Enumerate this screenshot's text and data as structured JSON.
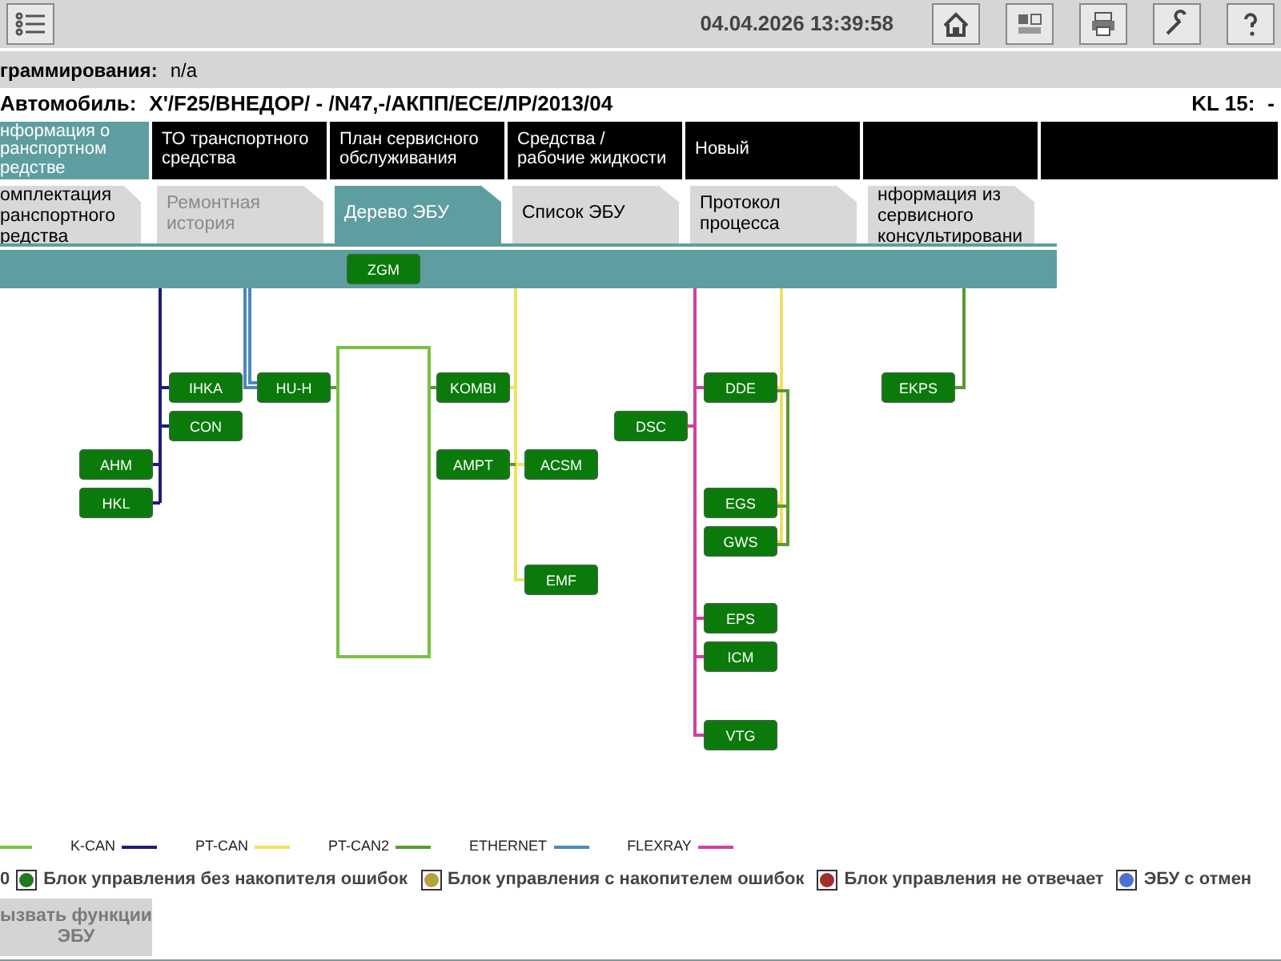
{
  "header": {
    "datetime": "04.04.2026 13:39:58"
  },
  "info": {
    "program_label": "граммирования:",
    "program_value": "n/a",
    "vehicle_label": "Автомобиль:",
    "vehicle_value": "X'/F25/ВНЕДОР/ - /N47,-/АКПП/ЕСЕ/ЛР/2013/04",
    "kl_label": "KL 15:",
    "kl_value": "-"
  },
  "main_tabs": [
    {
      "label": "нформация о\nранспортном\nредстве",
      "selected": true
    },
    {
      "label": "ТО транспортного\nсредства",
      "selected": false
    },
    {
      "label": "План сервисного\nобслуживания",
      "selected": false
    },
    {
      "label": "Средства /\nрабочие жидкости",
      "selected": false
    },
    {
      "label": "Новый",
      "selected": false
    },
    {
      "selected": false
    },
    {
      "selected": false
    }
  ],
  "sub_tabs": [
    {
      "label": "омплектация\nранспортного\nредства",
      "selected": false,
      "disabled": false
    },
    {
      "label": "Ремонтная\nистория",
      "selected": false,
      "disabled": true
    },
    {
      "label": "Дерево ЭБУ",
      "selected": true,
      "disabled": false
    },
    {
      "label": "Список ЭБУ",
      "selected": false,
      "disabled": false
    },
    {
      "label": "Протокол\nпроцесса",
      "selected": false,
      "disabled": false
    },
    {
      "label": "нформация из\nсервисного\nконсультировани",
      "selected": false,
      "disabled": false
    }
  ],
  "ecu_tree": {
    "root": "ZGM",
    "nodes": [
      "IHKA",
      "HU-H",
      "KOMBI",
      "CON",
      "AHM",
      "AMPT",
      "ACSM",
      "HKL",
      "EMF",
      "DSC",
      "DDE",
      "EKPS",
      "EGS",
      "GWS",
      "EPS",
      "ICM",
      "VTG"
    ]
  },
  "bus_legend": [
    {
      "color": "#7ac143"
    },
    {
      "label": "K-CAN",
      "color": "#1c1c80"
    },
    {
      "label": "PT-CAN",
      "color": "#f0e060"
    },
    {
      "label": "PT-CAN2",
      "color": "#5a9a30"
    },
    {
      "label": "ETHERNET",
      "color": "#4a88c0"
    },
    {
      "label": "FLEXRAY",
      "color": "#d040a0"
    }
  ],
  "status_legend": {
    "prefix": "0",
    "items": [
      {
        "label": "Блок управления без накопителя ошибок",
        "color": "#1e7a1e"
      },
      {
        "label": "Блок управления с накопителем ошибок",
        "color": "#b8a040"
      },
      {
        "label": "Блок управления не отвечает",
        "color": "#a03030"
      },
      {
        "label": "ЭБУ с отмен",
        "color": "#5070d0"
      }
    ]
  },
  "buttons": [
    {
      "label": "ызвать функции\nЭБУ",
      "disabled": true
    }
  ]
}
